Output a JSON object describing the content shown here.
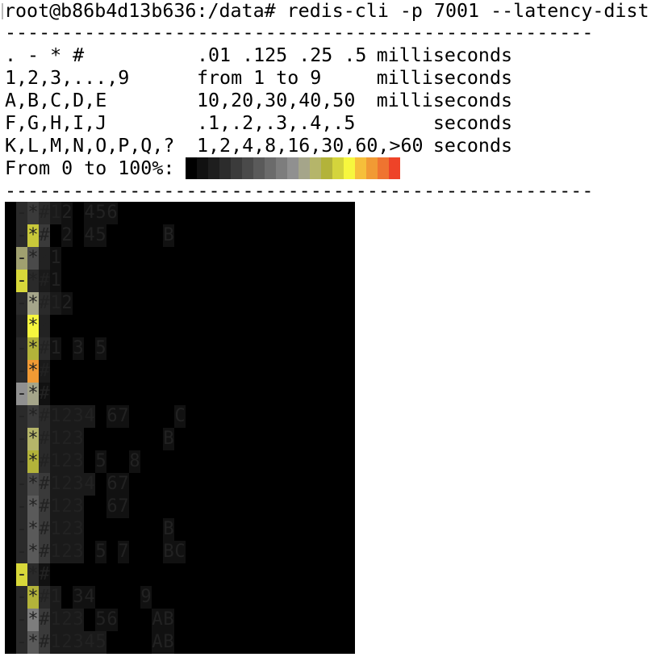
{
  "prompt_line": "root@b86b4d13b636:/data# redis-cli -p 7001 --latency-dist",
  "separator": "----------------------------------------------------",
  "legend": [
    {
      "symbols": ". - * #",
      "values": ".01 .125 .25 .5",
      "unit": "milliseconds"
    },
    {
      "symbols": "1,2,3,...,9",
      "values": "from 1 to 9",
      "unit": "milliseconds"
    },
    {
      "symbols": "A,B,C,D,E",
      "values": "10,20,30,40,50",
      "unit": "milliseconds"
    },
    {
      "symbols": "F,G,H,I,J",
      "values": ".1,.2,.3,.4,.5",
      "unit": "seconds"
    },
    {
      "symbols": "K,L,M,N,O,P,Q,?",
      "values": "1,2,4,8,16,30,60,>60",
      "unit": "seconds"
    }
  ],
  "scale_label": "From 0 to 100%:",
  "scale_colors": [
    "#000000",
    "#111111",
    "#1e1e1e",
    "#2c2c2c",
    "#3b3b3b",
    "#4a4a4a",
    "#5a5a5a",
    "#6b6b6b",
    "#7d7d7d",
    "#909090",
    "#a5a58a",
    "#b5b56a",
    "#b3b33a",
    "#d4d43c",
    "#f7f73e",
    "#f6bf3a",
    "#f19a34",
    "#ef7430",
    "#ee4328"
  ],
  "histogram": [
    {
      "cells": [
        [
          "-",
          "#2a2a2a"
        ],
        [
          "*",
          "#3a3a3a"
        ],
        [
          "#",
          "#2a2a2a"
        ],
        [
          "1",
          "#1a1a1a"
        ],
        [
          "2",
          "#111111"
        ],
        [
          " ",
          "#000000"
        ],
        [
          "4",
          "#111111"
        ],
        [
          "5",
          "#111111"
        ],
        [
          "6",
          "#111111"
        ]
      ]
    },
    {
      "cells": [
        [
          "-",
          "#2a2a2a"
        ],
        [
          "*",
          "#c8c83a"
        ],
        [
          "#",
          "#3a3a3a"
        ],
        [
          " ",
          "#000000"
        ],
        [
          "2",
          "#111111"
        ],
        [
          " ",
          "#000000"
        ],
        [
          "4",
          "#111111"
        ],
        [
          "5",
          "#111111"
        ],
        [
          " ",
          "#000000"
        ],
        [
          " ",
          "#000000"
        ],
        [
          " ",
          "#000000"
        ],
        [
          " ",
          "#000000"
        ],
        [
          " ",
          "#000000"
        ],
        [
          "B",
          "#111111"
        ]
      ]
    },
    {
      "cells": [
        [
          "-",
          "#a0a070"
        ],
        [
          "*",
          "#4a4a4a"
        ],
        [
          "#",
          "#222222"
        ],
        [
          "1",
          "#111111"
        ]
      ]
    },
    {
      "cells": [
        [
          "-",
          "#d8d83a"
        ],
        [
          "*",
          "#2a2a2a"
        ],
        [
          "#",
          "#1a1a1a"
        ],
        [
          "1",
          "#111111"
        ]
      ]
    },
    {
      "cells": [
        [
          "-",
          "#2a2a2a"
        ],
        [
          "*",
          "#a5a58a"
        ],
        [
          "#",
          "#2a2a2a"
        ],
        [
          "1",
          "#1a1a1a"
        ],
        [
          "2",
          "#111111"
        ]
      ]
    },
    {
      "cells": [
        [
          "-",
          "#222222"
        ],
        [
          "*",
          "#f7f73e"
        ],
        [
          "#",
          "#222222"
        ]
      ]
    },
    {
      "cells": [
        [
          "-",
          "#2a2a2a"
        ],
        [
          "*",
          "#b3b33a"
        ],
        [
          "#",
          "#2a2a2a"
        ],
        [
          "1",
          "#111111"
        ],
        [
          " ",
          "#000000"
        ],
        [
          "3",
          "#111111"
        ],
        [
          " ",
          "#000000"
        ],
        [
          "5",
          "#111111"
        ]
      ]
    },
    {
      "cells": [
        [
          "-",
          "#2a2a2a"
        ],
        [
          "*",
          "#f19a34"
        ],
        [
          "#",
          "#1a1a1a"
        ]
      ]
    },
    {
      "cells": [
        [
          "-",
          "#909090"
        ],
        [
          "*",
          "#a5a58a"
        ],
        [
          "#",
          "#111111"
        ]
      ]
    },
    {
      "cells": [
        [
          "-",
          "#2a2a2a"
        ],
        [
          "*",
          "#3a3a3a"
        ],
        [
          "#",
          "#2a2a2a"
        ],
        [
          "1",
          "#1a1a1a"
        ],
        [
          "2",
          "#1a1a1a"
        ],
        [
          "3",
          "#1a1a1a"
        ],
        [
          "4",
          "#1a1a1a"
        ],
        [
          " ",
          "#000000"
        ],
        [
          "6",
          "#111111"
        ],
        [
          "7",
          "#111111"
        ],
        [
          " ",
          "#000000"
        ],
        [
          " ",
          "#000000"
        ],
        [
          " ",
          "#000000"
        ],
        [
          " ",
          "#000000"
        ],
        [
          "C",
          "#111111"
        ]
      ]
    },
    {
      "cells": [
        [
          "-",
          "#2a2a2a"
        ],
        [
          "*",
          "#b5b56a"
        ],
        [
          "#",
          "#2a2a2a"
        ],
        [
          "1",
          "#1a1a1a"
        ],
        [
          "2",
          "#1a1a1a"
        ],
        [
          "3",
          "#1a1a1a"
        ],
        [
          " ",
          "#000000"
        ],
        [
          " ",
          "#000000"
        ],
        [
          " ",
          "#000000"
        ],
        [
          " ",
          "#000000"
        ],
        [
          " ",
          "#000000"
        ],
        [
          " ",
          "#000000"
        ],
        [
          " ",
          "#000000"
        ],
        [
          "B",
          "#111111"
        ]
      ]
    },
    {
      "cells": [
        [
          "-",
          "#2a2a2a"
        ],
        [
          "*",
          "#b3b33a"
        ],
        [
          "#",
          "#2a2a2a"
        ],
        [
          "1",
          "#1a1a1a"
        ],
        [
          "2",
          "#1a1a1a"
        ],
        [
          "3",
          "#1a1a1a"
        ],
        [
          " ",
          "#000000"
        ],
        [
          "5",
          "#111111"
        ],
        [
          " ",
          "#000000"
        ],
        [
          " ",
          "#000000"
        ],
        [
          "8",
          "#111111"
        ]
      ]
    },
    {
      "cells": [
        [
          "-",
          "#2a2a2a"
        ],
        [
          "*",
          "#4a4a4a"
        ],
        [
          "#",
          "#3a3a3a"
        ],
        [
          "1",
          "#1a1a1a"
        ],
        [
          "2",
          "#1a1a1a"
        ],
        [
          "3",
          "#1a1a1a"
        ],
        [
          "4",
          "#1a1a1a"
        ],
        [
          " ",
          "#000000"
        ],
        [
          "6",
          "#111111"
        ],
        [
          "7",
          "#111111"
        ]
      ]
    },
    {
      "cells": [
        [
          "-",
          "#2a2a2a"
        ],
        [
          "*",
          "#5a5a5a"
        ],
        [
          "#",
          "#3a3a3a"
        ],
        [
          "1",
          "#1a1a1a"
        ],
        [
          "2",
          "#1a1a1a"
        ],
        [
          "3",
          "#1a1a1a"
        ],
        [
          " ",
          "#000000"
        ],
        [
          " ",
          "#000000"
        ],
        [
          "6",
          "#111111"
        ],
        [
          "7",
          "#111111"
        ]
      ]
    },
    {
      "cells": [
        [
          "-",
          "#2a2a2a"
        ],
        [
          "*",
          "#5a5a5a"
        ],
        [
          "#",
          "#3a3a3a"
        ],
        [
          "1",
          "#1a1a1a"
        ],
        [
          "2",
          "#1a1a1a"
        ],
        [
          "3",
          "#1a1a1a"
        ],
        [
          " ",
          "#000000"
        ],
        [
          " ",
          "#000000"
        ],
        [
          " ",
          "#000000"
        ],
        [
          " ",
          "#000000"
        ],
        [
          " ",
          "#000000"
        ],
        [
          " ",
          "#000000"
        ],
        [
          " ",
          "#000000"
        ],
        [
          "B",
          "#111111"
        ]
      ]
    },
    {
      "cells": [
        [
          "-",
          "#2a2a2a"
        ],
        [
          "*",
          "#5a5a5a"
        ],
        [
          "#",
          "#3a3a3a"
        ],
        [
          "1",
          "#1a1a1a"
        ],
        [
          "2",
          "#1a1a1a"
        ],
        [
          "3",
          "#1a1a1a"
        ],
        [
          " ",
          "#000000"
        ],
        [
          "5",
          "#111111"
        ],
        [
          " ",
          "#000000"
        ],
        [
          "7",
          "#111111"
        ],
        [
          " ",
          "#000000"
        ],
        [
          " ",
          "#000000"
        ],
        [
          " ",
          "#000000"
        ],
        [
          "B",
          "#111111"
        ],
        [
          "C",
          "#111111"
        ]
      ]
    },
    {
      "cells": [
        [
          "-",
          "#d8d83a"
        ],
        [
          "*",
          "#2a2a2a"
        ],
        [
          "#",
          "#111111"
        ]
      ]
    },
    {
      "cells": [
        [
          "-",
          "#2a2a2a"
        ],
        [
          "*",
          "#b3b33a"
        ],
        [
          "#",
          "#2a2a2a"
        ],
        [
          "1",
          "#1a1a1a"
        ],
        [
          " ",
          "#000000"
        ],
        [
          "3",
          "#111111"
        ],
        [
          "4",
          "#111111"
        ],
        [
          " ",
          "#000000"
        ],
        [
          " ",
          "#000000"
        ],
        [
          " ",
          "#000000"
        ],
        [
          " ",
          "#000000"
        ],
        [
          "9",
          "#111111"
        ]
      ]
    },
    {
      "cells": [
        [
          "-",
          "#2a2a2a"
        ],
        [
          "*",
          "#7d7d7d"
        ],
        [
          "#",
          "#3a3a3a"
        ],
        [
          "1",
          "#1a1a1a"
        ],
        [
          "2",
          "#1a1a1a"
        ],
        [
          "3",
          "#1a1a1a"
        ],
        [
          " ",
          "#000000"
        ],
        [
          "5",
          "#111111"
        ],
        [
          "6",
          "#111111"
        ],
        [
          " ",
          "#000000"
        ],
        [
          " ",
          "#000000"
        ],
        [
          " ",
          "#000000"
        ],
        [
          "A",
          "#111111"
        ],
        [
          "B",
          "#111111"
        ]
      ]
    },
    {
      "cells": [
        [
          "-",
          "#2a2a2a"
        ],
        [
          "*",
          "#5a5a5a"
        ],
        [
          "#",
          "#3a3a3a"
        ],
        [
          "1",
          "#1a1a1a"
        ],
        [
          "2",
          "#1a1a1a"
        ],
        [
          "3",
          "#1a1a1a"
        ],
        [
          "4",
          "#1a1a1a"
        ],
        [
          "5",
          "#1a1a1a"
        ],
        [
          " ",
          "#000000"
        ],
        [
          " ",
          "#000000"
        ],
        [
          " ",
          "#000000"
        ],
        [
          " ",
          "#000000"
        ],
        [
          "A",
          "#111111"
        ],
        [
          "B",
          "#111111"
        ]
      ]
    }
  ]
}
